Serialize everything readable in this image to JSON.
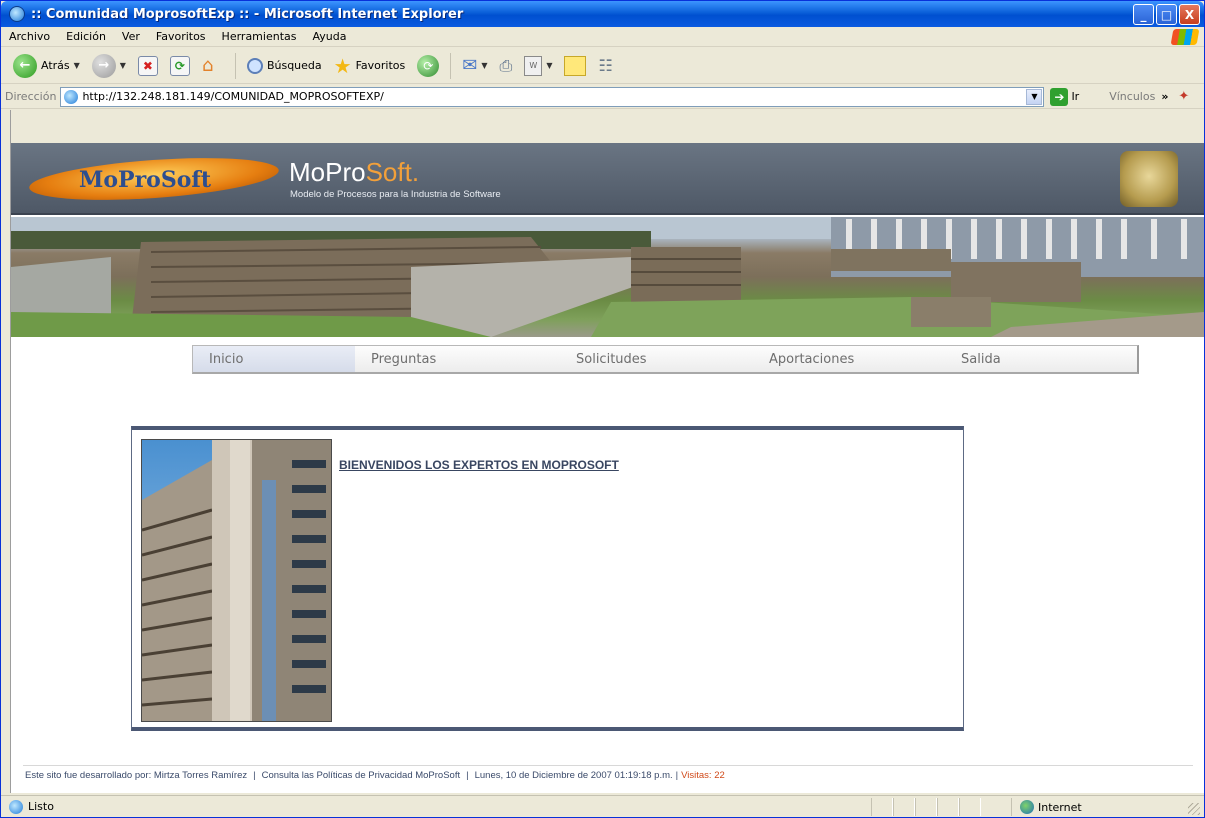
{
  "window": {
    "title": ":: Comunidad MoprosoftExp :: - Microsoft Internet Explorer",
    "controls": {
      "minimize": "_",
      "maximize": "□",
      "close": "X"
    }
  },
  "menu": [
    "Archivo",
    "Edición",
    "Ver",
    "Favoritos",
    "Herramientas",
    "Ayuda"
  ],
  "toolbar": {
    "back_label": "Atrás",
    "search_label": "Búsqueda",
    "favorites_label": "Favoritos",
    "doc_icon_text": "W",
    "icons": [
      "back-arrow-icon",
      "forward-arrow-icon",
      "stop-icon",
      "refresh-icon",
      "home-icon",
      "search-icon",
      "favorites-star-icon",
      "history-icon",
      "mail-icon",
      "print-icon",
      "edit-icon",
      "discuss-icon",
      "research-icon"
    ]
  },
  "address": {
    "label": "Dirección",
    "url": "http://132.248.181.149/COMUNIDAD_MOPROSOFTEXP/",
    "go_label": "Ir",
    "links_label": "Vínculos",
    "chevron": "»"
  },
  "site": {
    "logo_text": "MoProSoft",
    "title_a": "MoPro",
    "title_b": "Soft.",
    "subtitle": "Modelo de Procesos para la Industria de Software"
  },
  "nav": [
    {
      "label": "Inicio",
      "active": true
    },
    {
      "label": "Preguntas",
      "active": false
    },
    {
      "label": "Solicitudes",
      "active": false
    },
    {
      "label": "Aportaciones",
      "active": false
    },
    {
      "label": "Salida",
      "active": false
    }
  ],
  "main": {
    "welcome": "BIENVENIDOS LOS EXPERTOS EN MOPROSOFT"
  },
  "footer": {
    "developer": "Este sito fue desarrollado por: Mirtza Torres Ramírez",
    "privacy": "Consulta las Políticas de Privacidad MoProSoft",
    "datetime": "Lunes, 10 de Diciembre de 2007 01:19:18 p.m.",
    "visits": "Visitas: 22",
    "separator": "|"
  },
  "status": {
    "text": "Listo",
    "zone": "Internet"
  },
  "colors": {
    "header_bg": "#5a6472",
    "accent_orange": "#f2a03a",
    "box_border": "#4b5874",
    "visits": "#d04a1a"
  }
}
